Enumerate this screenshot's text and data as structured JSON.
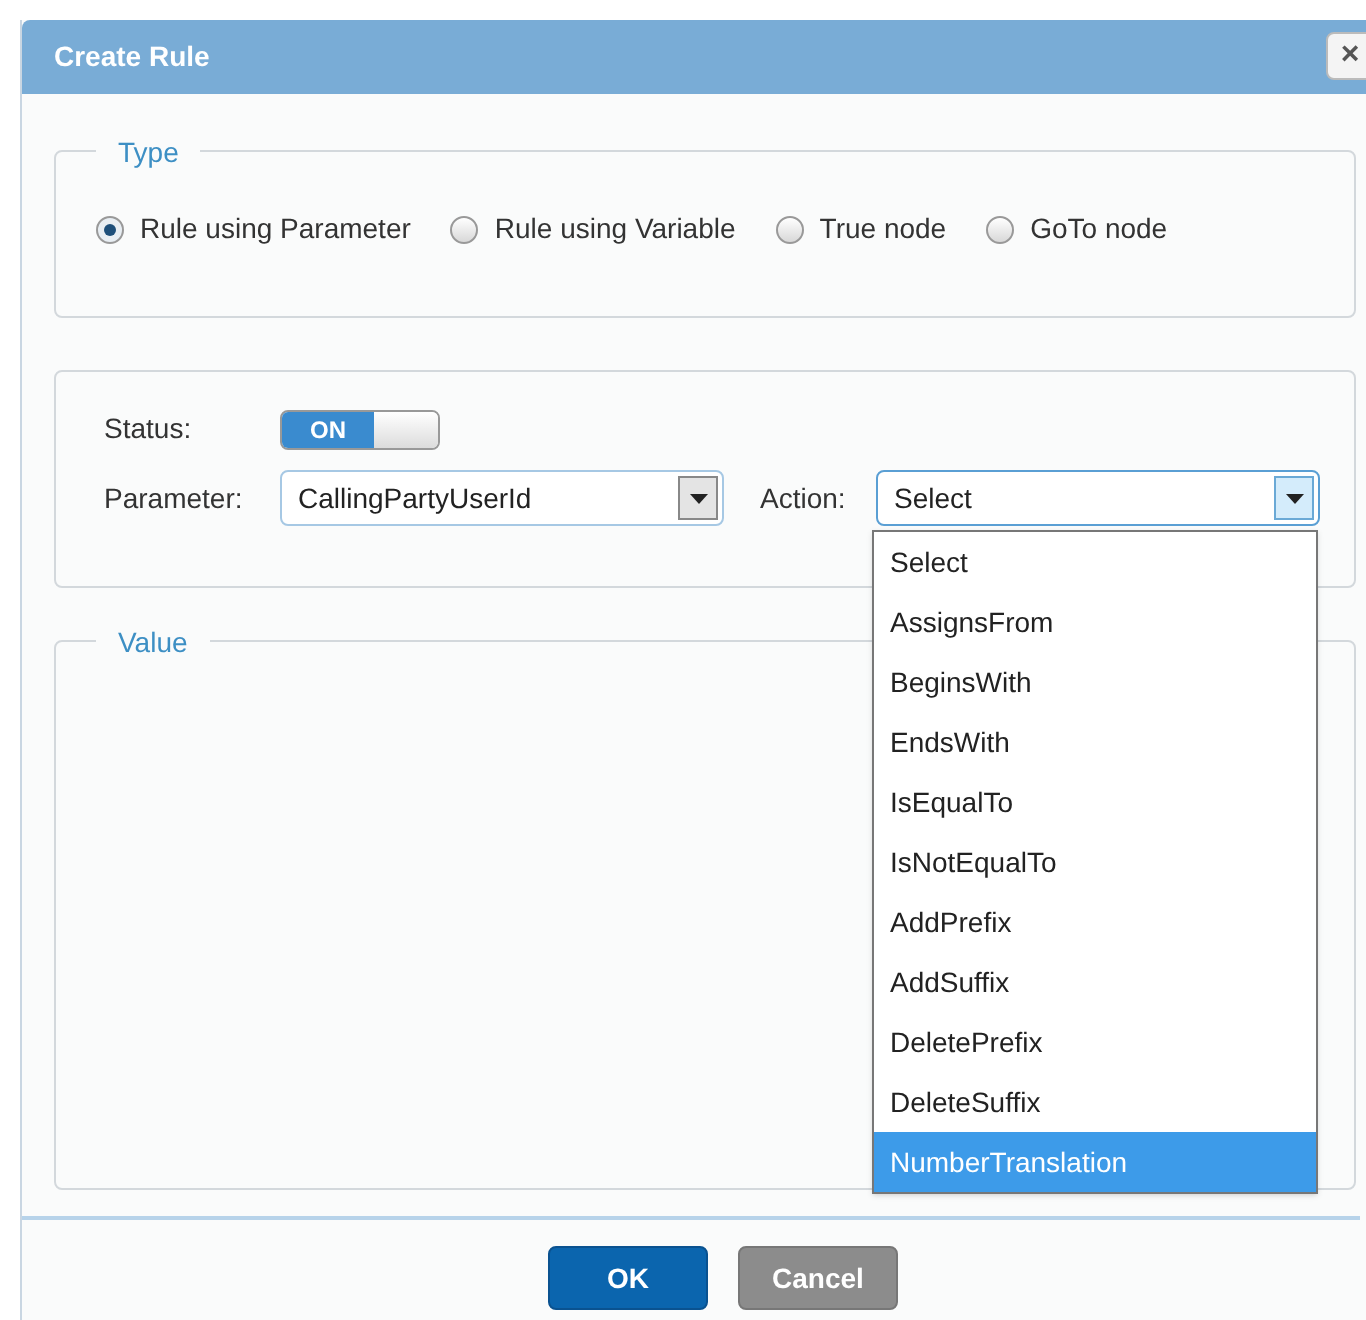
{
  "dialog": {
    "title": "Create Rule",
    "close": "×"
  },
  "type_group": {
    "legend": "Type",
    "options": [
      {
        "label": "Rule using Parameter",
        "selected": true
      },
      {
        "label": "Rule using Variable",
        "selected": false
      },
      {
        "label": "True node",
        "selected": false
      },
      {
        "label": "GoTo node",
        "selected": false
      }
    ]
  },
  "status": {
    "label": "Status:",
    "toggle_text": "ON",
    "on": true
  },
  "parameter": {
    "label": "Parameter:",
    "value": "CallingPartyUserId"
  },
  "action": {
    "label": "Action:",
    "value": "Select",
    "expanded": true,
    "options": [
      {
        "label": "Select",
        "highlighted": false
      },
      {
        "label": "AssignsFrom",
        "highlighted": false
      },
      {
        "label": "BeginsWith",
        "highlighted": false
      },
      {
        "label": "EndsWith",
        "highlighted": false
      },
      {
        "label": "IsEqualTo",
        "highlighted": false
      },
      {
        "label": "IsNotEqualTo",
        "highlighted": false
      },
      {
        "label": "AddPrefix",
        "highlighted": false
      },
      {
        "label": "AddSuffix",
        "highlighted": false
      },
      {
        "label": "DeletePrefix",
        "highlighted": false
      },
      {
        "label": "DeleteSuffix",
        "highlighted": false
      },
      {
        "label": "NumberTranslation",
        "highlighted": true
      }
    ]
  },
  "value_group": {
    "legend": "Value"
  },
  "buttons": [
    {
      "label": "OK",
      "kind": "primary"
    },
    {
      "label": "Cancel",
      "kind": "secondary"
    }
  ]
}
